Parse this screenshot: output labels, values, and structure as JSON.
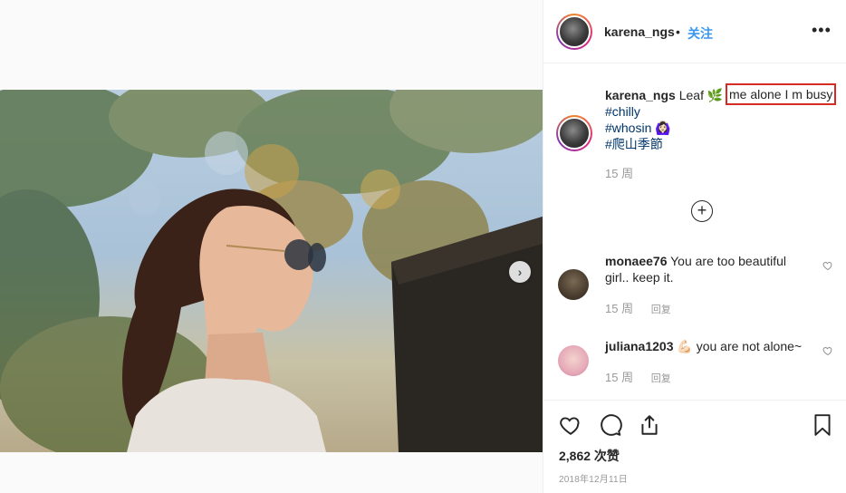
{
  "media": {
    "next_icon": "chevron-right-icon"
  },
  "header": {
    "username": "karena_ngs",
    "dot": "•",
    "follow_label": "关注",
    "more_icon": "more-horizontal-icon"
  },
  "caption": {
    "username": "karena_ngs",
    "text": "Leaf",
    "emoji": "🌿",
    "highlighted_text": "me alone I m busy",
    "hashtags": [
      "#chilly",
      "#whosin",
      "#爬山季節"
    ],
    "whosin_emoji": "🙆🏻‍♀️",
    "time": "15 周"
  },
  "load_more_icon": "plus-circle-icon",
  "comments": [
    {
      "username": "monaee76",
      "text": "You are too beautiful girl.. keep it.",
      "time": "15 周",
      "reply_label": "回复"
    },
    {
      "username": "juliana1203",
      "emoji": "💪🏻",
      "text": "you are not alone~",
      "time": "15 周",
      "reply_label": "回复"
    }
  ],
  "actions": {
    "icons": [
      "heart-icon",
      "comment-icon",
      "share-icon",
      "bookmark-icon"
    ],
    "likes": "2,862 次赞",
    "date": "2018年12月11日"
  },
  "colors": {
    "link": "#3897f0",
    "hashtag": "#003569",
    "highlight_border": "#d62a24",
    "muted": "#999999"
  }
}
